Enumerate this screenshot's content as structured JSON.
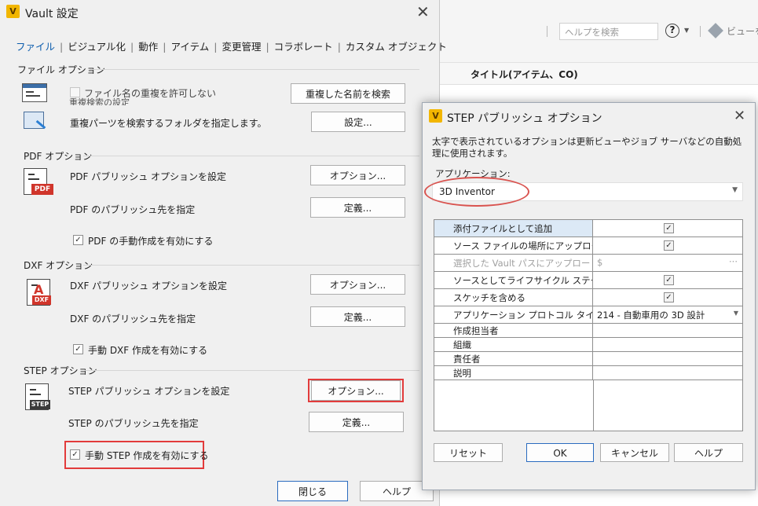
{
  "background_app": {
    "help_placeholder": "ヘルプを検索",
    "view_label": "ビューを共",
    "column_title": "タイトル(アイテム、CO)"
  },
  "vault_dialog": {
    "title": "Vault 設定",
    "tabs": [
      "ファイル",
      "ビジュアル化",
      "動作",
      "アイテム",
      "変更管理",
      "コラボレート",
      "カスタム オブジェクト"
    ],
    "file_options": {
      "header": "ファイル オプション",
      "allow_duplicate_label": "ファイル名の重複を許可しない",
      "allow_duplicate_checked": false,
      "find_duplicate_button": "重複した名前を検索",
      "duplicate_search_settings": "重複検索の設定",
      "folder_label": "重複パーツを検索するフォルダを指定します。",
      "settings_button": "設定..."
    },
    "pdf_options": {
      "header": "PDF オプション",
      "set_options_label": "PDF パブリッシュ オプションを設定",
      "options_button": "オプション...",
      "publish_dest_label": "PDF のパブリッシュ先を指定",
      "define_button": "定義...",
      "manual_label": "PDF の手動作成を有効にする",
      "manual_checked": true,
      "icon_badge": "PDF"
    },
    "dxf_options": {
      "header": "DXF オプション",
      "set_options_label": "DXF パブリッシュ オプションを設定",
      "options_button": "オプション...",
      "publish_dest_label": "DXF のパブリッシュ先を指定",
      "define_button": "定義...",
      "manual_label": "手動 DXF 作成を有効にする",
      "manual_checked": true,
      "icon_badge": "DXF"
    },
    "step_options": {
      "header": "STEP オプション",
      "set_options_label": "STEP パブリッシュ オプションを設定",
      "options_button": "オプション...",
      "publish_dest_label": "STEP のパブリッシュ先を指定",
      "define_button": "定義...",
      "manual_label": "手動 STEP 作成を有効にする",
      "manual_checked": true,
      "icon_badge": "STEP"
    },
    "close_button": "閉じる",
    "help_button": "ヘルプ"
  },
  "step_dialog": {
    "title": "STEP パブリッシュ オプション",
    "description": "太字で表示されているオプションは更新ビューやジョブ サーバなどの自動処理に使用されます。",
    "application_label": "アプリケーション:",
    "application_value": "3D Inventor",
    "properties": [
      {
        "name": "添付ファイルとして追加",
        "type": "check",
        "checked": true
      },
      {
        "name": "ソース ファイルの場所にアップロード",
        "type": "check",
        "checked": true
      },
      {
        "name": "選択した Vault パスにアップロード",
        "type": "path",
        "value": "$",
        "disabled": true
      },
      {
        "name": "ソースとしてライフサイクル ステータス...",
        "type": "check",
        "checked": true
      },
      {
        "name": "スケッチを含める",
        "type": "check",
        "checked": true
      },
      {
        "name": "アプリケーション プロトコル タイプ",
        "type": "select",
        "value": "214 - 自動車用の 3D 設計"
      },
      {
        "name": "作成担当者",
        "type": "text",
        "value": ""
      },
      {
        "name": "組織",
        "type": "text",
        "value": ""
      },
      {
        "name": "責任者",
        "type": "text",
        "value": ""
      },
      {
        "name": "説明",
        "type": "text",
        "value": ""
      }
    ],
    "reset_button": "リセット",
    "ok_button": "OK",
    "cancel_button": "キャンセル",
    "help_button": "ヘルプ"
  },
  "colors": {
    "accent": "#0b5cad",
    "highlight_red": "#e23b3b",
    "vault_logo": "#f2b600"
  }
}
